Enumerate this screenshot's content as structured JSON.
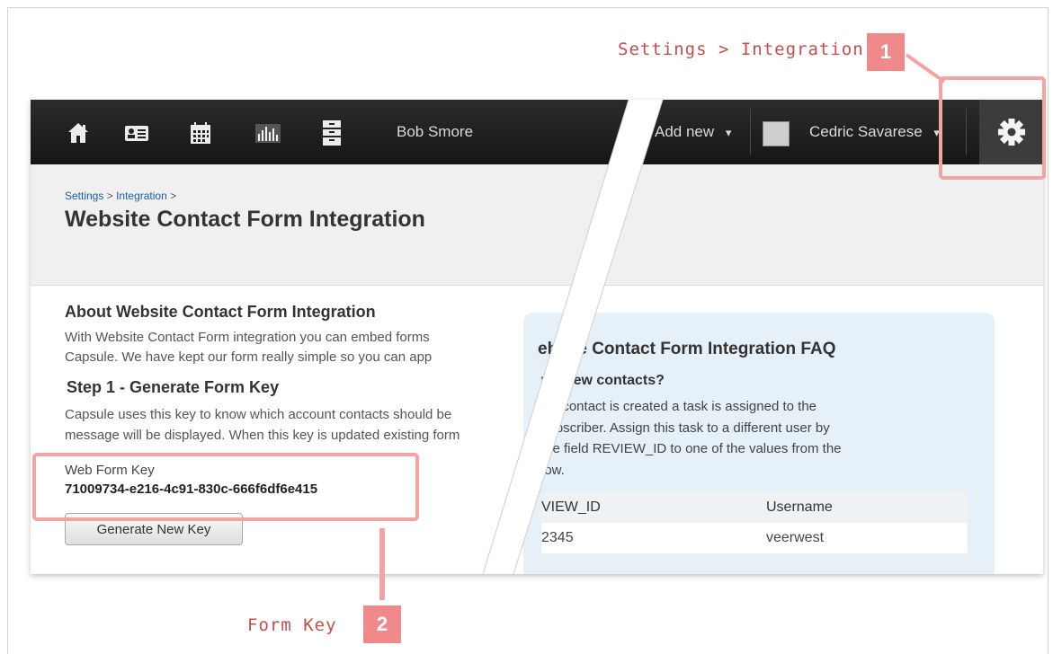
{
  "callouts": {
    "settings_label": "Settings > Integration",
    "settings_number": "1",
    "formkey_label": "Form Key",
    "formkey_number": "2"
  },
  "topbar": {
    "icons": [
      "home-icon",
      "contact-card-icon",
      "calendar-icon",
      "chart-icon",
      "cabinet-icon"
    ],
    "user_name": "Bob Smore",
    "add_new": "Add new",
    "add_new_caret": "▾",
    "account_name": "Cedric Savarese",
    "account_caret": "▾",
    "settings_icon": "gear-icon"
  },
  "breadcrumb": {
    "settings": "Settings",
    "integration": "Integration",
    "separator": ">"
  },
  "page_title": "Website Contact Form Integration",
  "about": {
    "heading": "About Website Contact Form Integration",
    "line1": "With Website Contact Form integration you can embed forms",
    "line2": "Capsule. We have kept our form really simple so you can app"
  },
  "step1": {
    "heading": "Step 1 - Generate Form Key",
    "line1": "Capsule uses this key to know which account contacts should be",
    "line2": "message will be displayed. When this key is updated existing form"
  },
  "web_form_key": {
    "label": "Web Form Key",
    "value": "71009734-e216-4c91-830c-666f6df6e415"
  },
  "generate_button": "Generate New Key",
  "faq": {
    "title": "ebsite Contact Form Integration FAQ",
    "question": "ws new contacts?",
    "line1": "ew contact is created a task is assigned to the",
    "line2": "subscriber. Assign this task to a different user by",
    "line3": "the field REVIEW_ID to one of the values from the",
    "line4": "low.",
    "table": {
      "headers": [
        "VIEW_ID",
        "Username"
      ],
      "rows": [
        [
          "2345",
          "veerwest"
        ]
      ]
    }
  },
  "colors": {
    "callout": "#c0504d",
    "highlight": "#f2a3a3",
    "badge": "#f08a8a",
    "topbar": "#1e1e1e",
    "link": "#1a5fa0",
    "faq_bg": "#e6f0f8"
  }
}
